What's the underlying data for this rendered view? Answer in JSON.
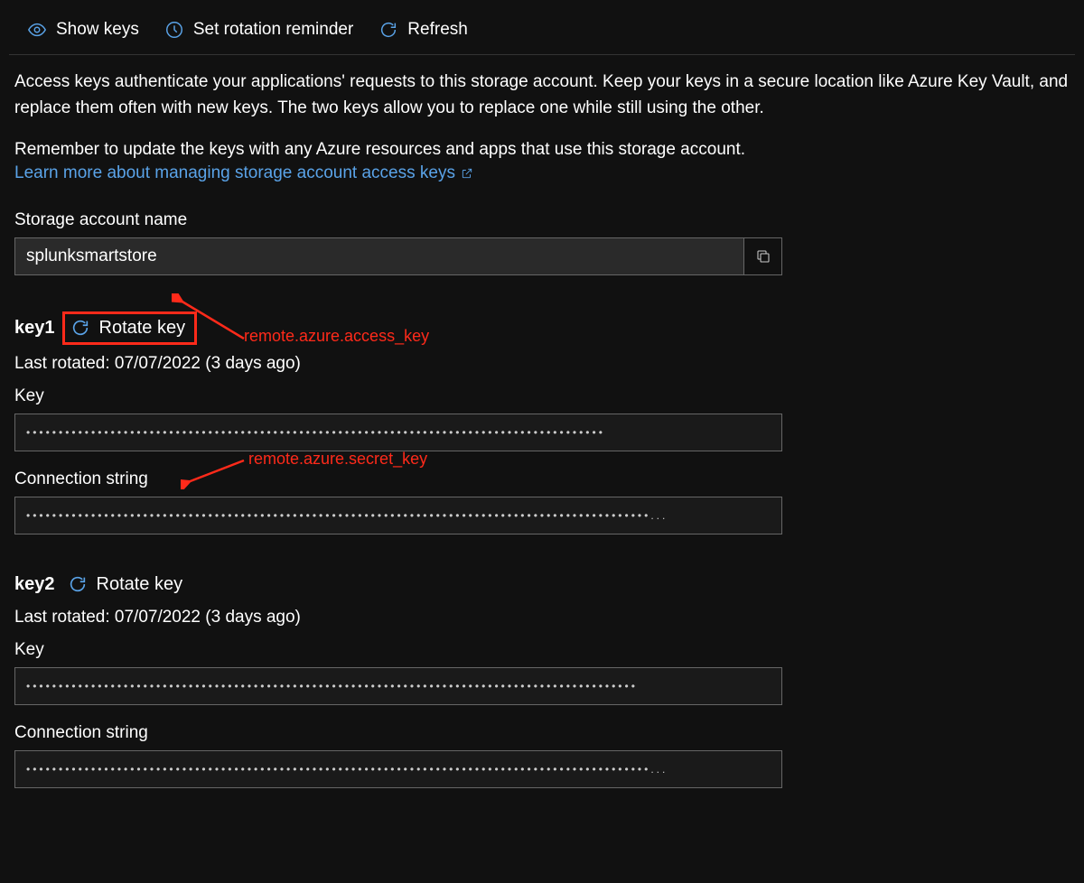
{
  "toolbar": {
    "show_keys": "Show keys",
    "set_reminder": "Set rotation reminder",
    "refresh": "Refresh"
  },
  "description": "Access keys authenticate your applications' requests to this storage account. Keep your keys in a secure location like Azure Key Vault, and replace them often with new keys. The two keys allow you to replace one while still using the other.",
  "reminder_text": "Remember to update the keys with any Azure resources and apps that use this storage account.",
  "learn_more": "Learn more about managing storage account access keys",
  "storage_label": "Storage account name",
  "storage_value": "splunksmartstore",
  "key1": {
    "name": "key1",
    "rotate_label": "Rotate key",
    "last_rotated": "Last rotated: 07/07/2022 (3 days ago)",
    "key_label": "Key",
    "key_value": "•••••••••••••••••••••••••••••••••••••••••••••••••••••••••••••••••••••••••••••••••••••••••",
    "cs_label": "Connection string",
    "cs_value": "••••••••••••••••••••••••••••••••••••••••••••••••••••••••••••••••••••••••••••••••••••••••••••••••..."
  },
  "key2": {
    "name": "key2",
    "rotate_label": "Rotate key",
    "last_rotated": "Last rotated: 07/07/2022 (3 days ago)",
    "key_label": "Key",
    "key_value": "••••••••••••••••••••••••••••••••••••••••••••••••••••••••••••••••••••••••••••••••••••••••••••••",
    "cs_label": "Connection string",
    "cs_value": "••••••••••••••••••••••••••••••••••••••••••••••••••••••••••••••••••••••••••••••••••••••••••••••••..."
  },
  "annotations": {
    "access_key": "remote.azure.access_key",
    "secret_key": "remote.azure.secret_key"
  }
}
